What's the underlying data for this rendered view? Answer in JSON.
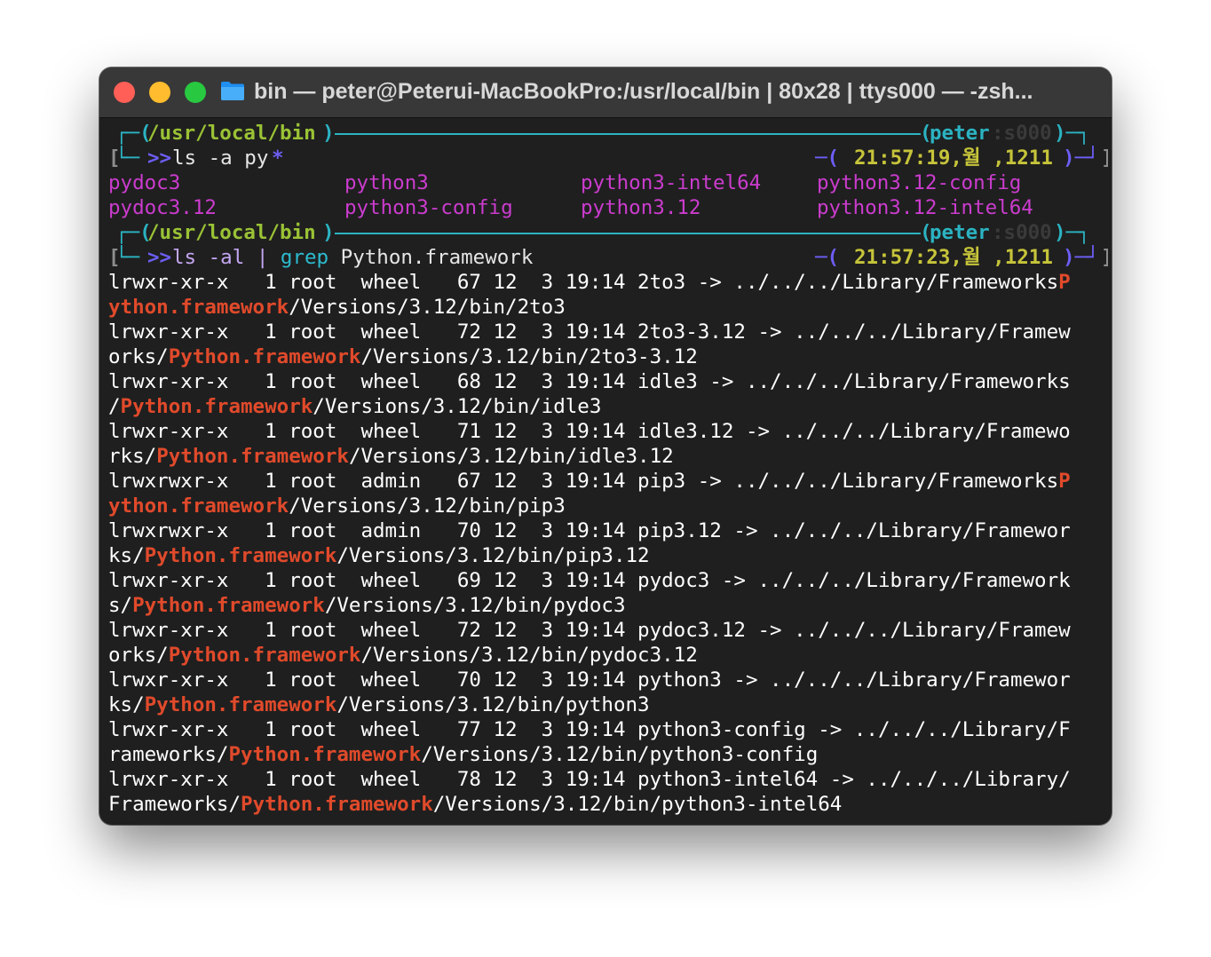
{
  "window": {
    "title": "bin — peter@Peterui-MacBookPro:/usr/local/bin | 80x28 | ttys000 — -zsh...",
    "buttons": {
      "close": "close",
      "minimize": "minimize",
      "zoom": "zoom"
    },
    "folder_icon": "folder-icon"
  },
  "colors": {
    "background": "#1f1f1f",
    "titlebar": "#383838",
    "prompt_border": "#2bb3c2",
    "path": "#9ac235",
    "prompt_arrows": "#6d5ef5",
    "time": "#c6c43a",
    "executable": "#cb3cce",
    "highlight": "#e04a2b"
  },
  "prompts": [
    {
      "top_left": "┌─(",
      "path": "/usr/local/bin",
      "path_close": ")",
      "top_right": "(peter:s000)─┐",
      "user": "peter",
      "session": ":s000",
      "command_prefix": "└─ ",
      "arrows": ">>",
      "command": "ls -a py",
      "command_star": "*",
      "time_prefix": "─(",
      "time": "21:57:19,월 ,1211",
      "time_suffix": ")─┘",
      "bracket_left": "[",
      "bracket_right": "]"
    },
    {
      "top_left": "┌─(",
      "path": "/usr/local/bin",
      "path_close": ")",
      "top_right": "(peter:s000)─┐",
      "user": "peter",
      "session": ":s000",
      "command_prefix": "└─ ",
      "arrows": ">>",
      "command_ls": "ls -al | ",
      "command_grep": "grep",
      "command_rest": " Python.framework",
      "time_prefix": "─(",
      "time": "21:57:23,월 ,1211",
      "time_suffix": ")─┘",
      "bracket_left": "[",
      "bracket_right": "]"
    }
  ],
  "ls_a_output": [
    [
      "pydoc3",
      "python3",
      "python3-intel64",
      "python3.12-config"
    ],
    [
      "pydoc3.12",
      "python3-config",
      "python3.12",
      "python3.12-intel64"
    ]
  ],
  "grep_output": [
    {
      "pre": "lrwxr-xr-x   1 root  wheel   67 12  3 19:14 2to3 -> ../../../Library/Frameworks",
      "hl": "P"
    },
    {
      "pre": "",
      "hl": "ython.framework",
      "post": "/Versions/3.12/bin/2to3"
    },
    {
      "pre": "lrwxr-xr-x   1 root  wheel   72 12  3 19:14 2to3-3.12 -> ../../../Library/Framew"
    },
    {
      "pre": "orks/",
      "hl": "Python.framework",
      "post": "/Versions/3.12/bin/2to3-3.12"
    },
    {
      "pre": "lrwxr-xr-x   1 root  wheel   68 12  3 19:14 idle3 -> ../../../Library/Frameworks"
    },
    {
      "pre": "/",
      "hl": "Python.framework",
      "post": "/Versions/3.12/bin/idle3"
    },
    {
      "pre": "lrwxr-xr-x   1 root  wheel   71 12  3 19:14 idle3.12 -> ../../../Library/Framewo"
    },
    {
      "pre": "rks/",
      "hl": "Python.framework",
      "post": "/Versions/3.12/bin/idle3.12"
    },
    {
      "pre": "lrwxrwxr-x   1 root  admin   67 12  3 19:14 pip3 -> ../../../Library/Frameworks",
      "hl": "P"
    },
    {
      "pre": "",
      "hl": "ython.framework",
      "post": "/Versions/3.12/bin/pip3"
    },
    {
      "pre": "lrwxrwxr-x   1 root  admin   70 12  3 19:14 pip3.12 -> ../../../Library/Framewor"
    },
    {
      "pre": "ks/",
      "hl": "Python.framework",
      "post": "/Versions/3.12/bin/pip3.12"
    },
    {
      "pre": "lrwxr-xr-x   1 root  wheel   69 12  3 19:14 pydoc3 -> ../../../Library/Framework"
    },
    {
      "pre": "s/",
      "hl": "Python.framework",
      "post": "/Versions/3.12/bin/pydoc3"
    },
    {
      "pre": "lrwxr-xr-x   1 root  wheel   72 12  3 19:14 pydoc3.12 -> ../../../Library/Framew"
    },
    {
      "pre": "orks/",
      "hl": "Python.framework",
      "post": "/Versions/3.12/bin/pydoc3.12"
    },
    {
      "pre": "lrwxr-xr-x   1 root  wheel   70 12  3 19:14 python3 -> ../../../Library/Framewor"
    },
    {
      "pre": "ks/",
      "hl": "Python.framework",
      "post": "/Versions/3.12/bin/python3"
    },
    {
      "pre": "lrwxr-xr-x   1 root  wheel   77 12  3 19:14 python3-config -> ../../../Library/F"
    },
    {
      "pre": "rameworks/",
      "hl": "Python.framework",
      "post": "/Versions/3.12/bin/python3-config"
    },
    {
      "pre": "lrwxr-xr-x   1 root  wheel   78 12  3 19:14 python3-intel64 -> ../../../Library/"
    },
    {
      "pre": "Frameworks/",
      "hl": "Python.framework",
      "post": "/Versions/3.12/bin/python3-intel64"
    }
  ]
}
